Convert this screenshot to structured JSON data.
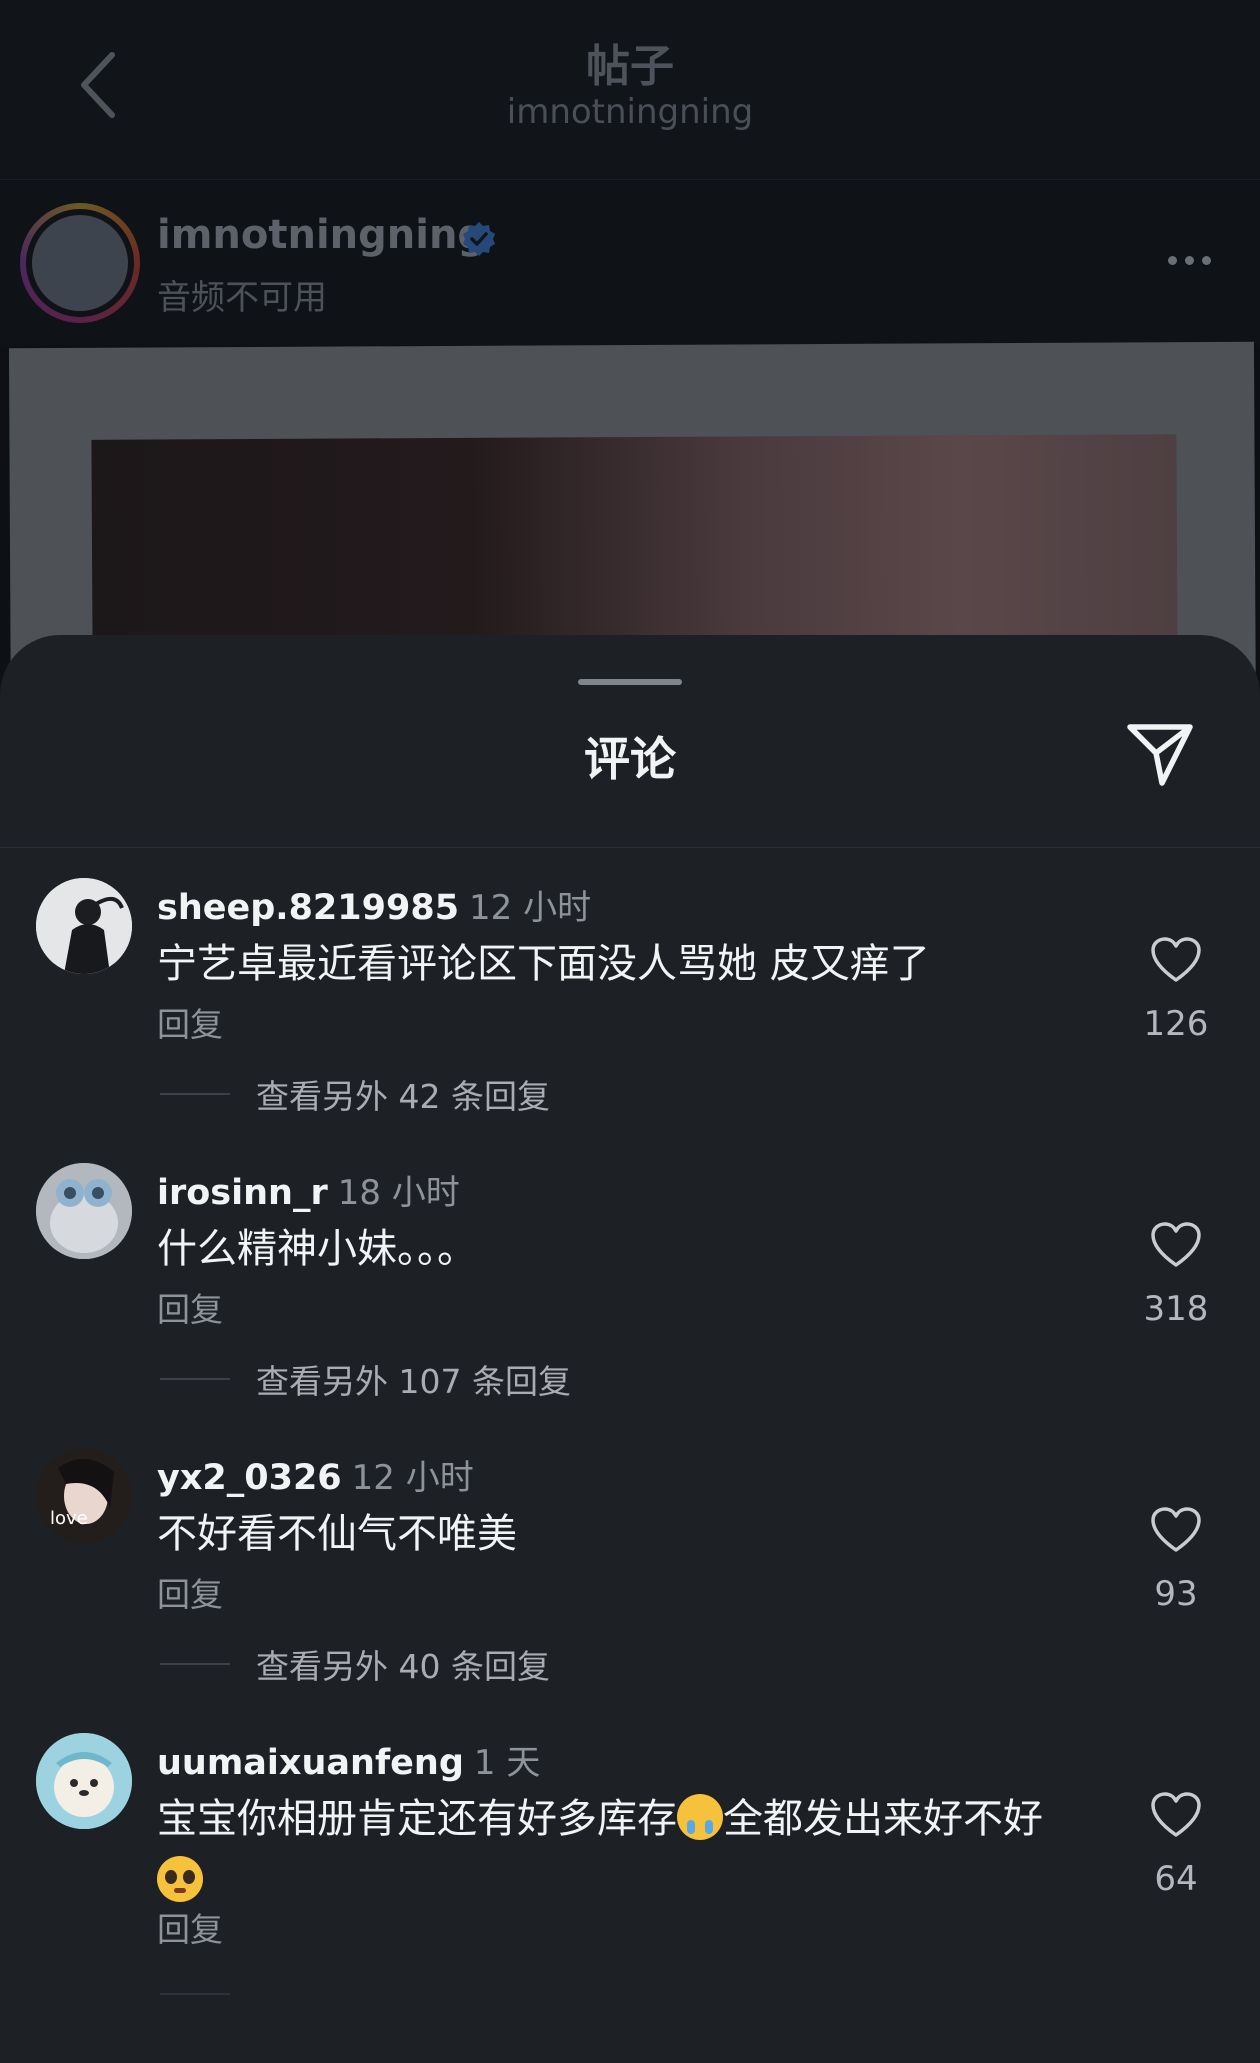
{
  "header": {
    "title": "帖子",
    "subtitle": "imnotningning"
  },
  "post": {
    "username": "imnotningning",
    "audio": "音频不可用"
  },
  "sheet": {
    "title": "评论"
  },
  "comments": [
    {
      "user": "sheep.8219985",
      "time": "12 小时",
      "text": "宁艺卓最近看评论区下面没人骂她 皮又痒了",
      "reply": "回复",
      "likes": "126",
      "more": "查看另外 42 条回复"
    },
    {
      "user": "irosinn_r",
      "time": "18 小时",
      "text": "什么精神小妹。。。",
      "reply": "回复",
      "likes": "318",
      "more": "查看另外 107 条回复"
    },
    {
      "user": "yx2_0326",
      "time": "12 小时",
      "text": "不好看不仙气不唯美",
      "reply": "回复",
      "likes": "93",
      "more": "查看另外 40 条回复",
      "avatar_text": "love"
    },
    {
      "user": "uumaixuanfeng",
      "time": "1 天",
      "text_a": "宝宝你相册肯定还有好多库存",
      "text_b": "全都发出来好不好",
      "reply": "回复",
      "likes": "64",
      "emojis": [
        "crying-face",
        "pleading-face"
      ]
    }
  ],
  "colors": {
    "sheet_bg": "#1d2126",
    "accent_verified": "#3d7bd4"
  }
}
